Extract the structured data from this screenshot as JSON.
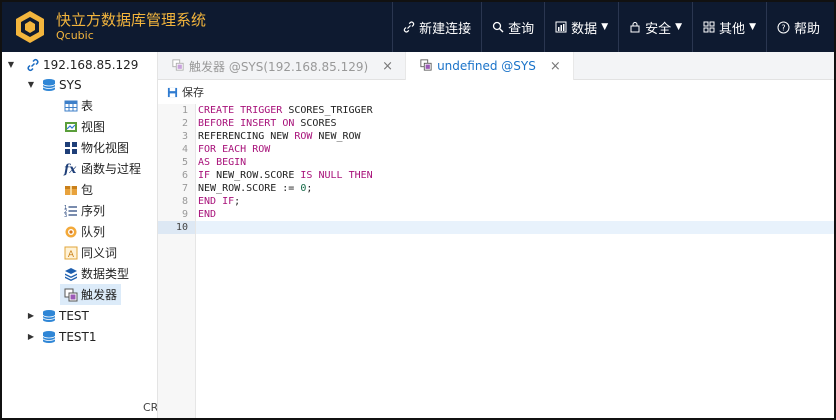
{
  "app": {
    "title": "快立方数据库管理系统",
    "subtitle": "Qcubic"
  },
  "nav": {
    "items": [
      {
        "label": "新建连接",
        "icon": "link-icon"
      },
      {
        "label": "查询",
        "icon": "search-icon"
      },
      {
        "label": "数据",
        "icon": "chart-icon",
        "dropdown": true
      },
      {
        "label": "安全",
        "icon": "lock-icon",
        "dropdown": true
      },
      {
        "label": "其他",
        "icon": "grid-icon",
        "dropdown": true
      },
      {
        "label": "帮助",
        "icon": "help-icon"
      }
    ]
  },
  "tree": {
    "connection": "192.168.85.129",
    "schema": "SYS",
    "items": [
      "表",
      "视图",
      "物化视图",
      "函数与过程",
      "包",
      "序列",
      "队列",
      "同义词",
      "数据类型",
      "触发器"
    ],
    "other_schemas": [
      "TEST",
      "TEST1"
    ],
    "footer": "CRE"
  },
  "tabs": [
    {
      "label": "触发器 @SYS(192.168.85.129)",
      "close": "×",
      "active": false
    },
    {
      "label": "undefined @SYS",
      "close": "×",
      "active": true
    }
  ],
  "toolbar": {
    "save_label": "保存"
  },
  "editor": {
    "line_numbers": [
      "1",
      "2",
      "3",
      "4",
      "5",
      "6",
      "7",
      "8",
      "9",
      "10"
    ],
    "current_line": 10
  },
  "colors": {
    "header_bg": "#0e1a30",
    "brand": "#f3b53d",
    "keyword": "#a8127a",
    "active_tab": "#1a73c9"
  }
}
